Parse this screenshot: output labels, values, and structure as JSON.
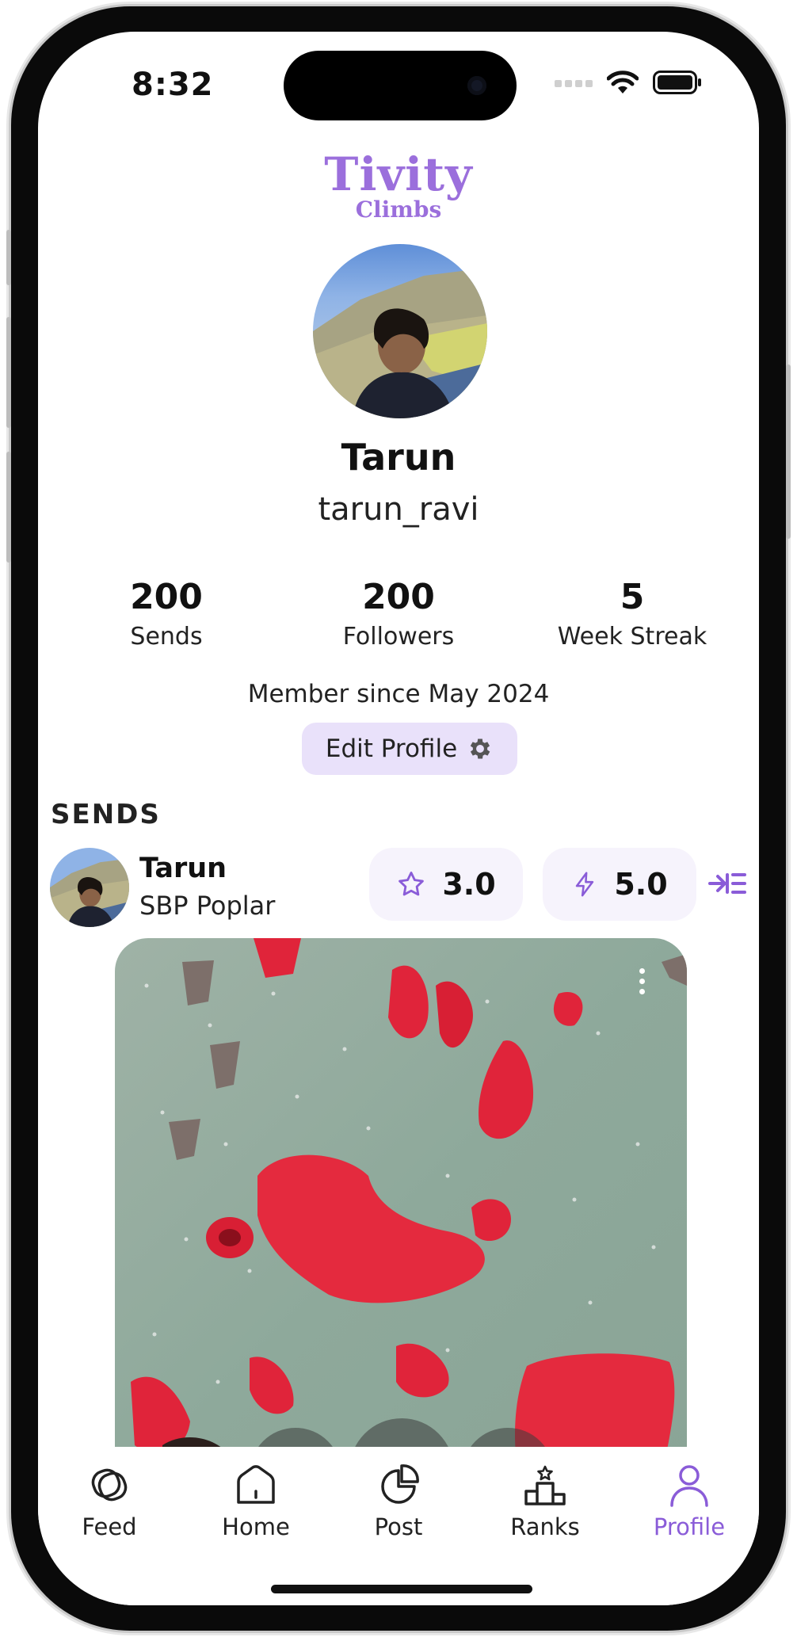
{
  "status_bar": {
    "time": "8:32"
  },
  "app": {
    "logo_line1": "Tivity",
    "logo_line2": "Climbs"
  },
  "profile": {
    "name": "Tarun",
    "username": "tarun_ravi",
    "stats": [
      {
        "value": "200",
        "label": "Sends"
      },
      {
        "value": "200",
        "label": "Followers"
      },
      {
        "value": "5",
        "label": "Week Streak"
      }
    ],
    "member_since": "Member since May 2024",
    "edit_button": "Edit Profile"
  },
  "sends_section": {
    "title": "SENDS",
    "post": {
      "user": "Tarun",
      "gym": "SBP Poplar",
      "star_rating": "3.0",
      "difficulty_rating": "5.0"
    }
  },
  "tabbar": {
    "items": [
      {
        "label": "Feed",
        "icon": "feed-icon"
      },
      {
        "label": "Home",
        "icon": "home-icon"
      },
      {
        "label": "Post",
        "icon": "post-icon"
      },
      {
        "label": "Ranks",
        "icon": "podium-icon"
      },
      {
        "label": "Profile",
        "icon": "person-icon"
      }
    ],
    "active": "Profile"
  },
  "colors": {
    "accent": "#8a5cd8",
    "logo": "#9b6fdc",
    "edit_button_bg": "#e9e1fa",
    "rating_bg": "#f6f3fc",
    "hold_red": "#e0243a",
    "wall_green": "#8faa9d"
  }
}
